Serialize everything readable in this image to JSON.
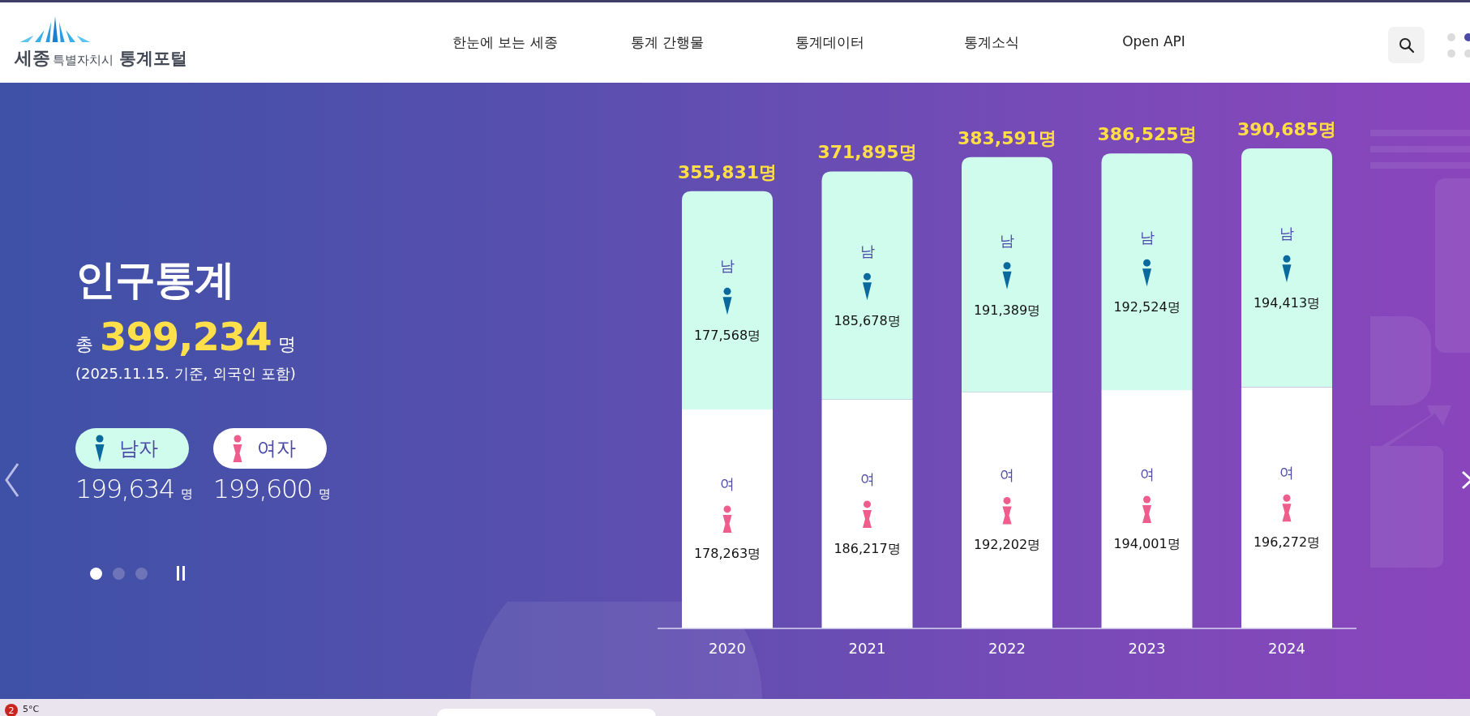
{
  "header": {
    "logo": {
      "city": "세종",
      "sub": "특별자치시",
      "portal": "통계포털"
    },
    "nav": [
      "한눈에 보는 세종",
      "통계 간행물",
      "통계데이터",
      "통계소식",
      "Open API"
    ]
  },
  "hero": {
    "title": "인구통계",
    "total": {
      "prefix": "총",
      "value": "399,234",
      "unit": "명"
    },
    "note": "(2025.11.15. 기준, 외국인 포함)",
    "genders": [
      {
        "kind": "male",
        "label": "남자",
        "value": "199,634",
        "unit": "명"
      },
      {
        "kind": "female",
        "label": "여자",
        "value": "199,600",
        "unit": "명"
      }
    ],
    "slides": [
      {
        "selected": true
      },
      {
        "selected": false
      },
      {
        "selected": false
      }
    ],
    "chart": {
      "bars": [
        {
          "total": "355,831명"
        },
        {
          "total": "371,895명"
        },
        {
          "total": "383,591명"
        },
        {
          "total": "386,525명"
        },
        {
          "total": "390,685명"
        }
      ],
      "chart_data": {
        "type": "bar",
        "stacked": true,
        "categories": [
          "2020",
          "2021",
          "2022",
          "2023",
          "2024"
        ],
        "series": [
          {
            "name": "남",
            "color": "#cffcec",
            "values": [
              177568,
              185678,
              191389,
              192524,
              194413
            ],
            "value_labels": [
              "177,568명",
              "185,678명",
              "191,389명",
              "192,524명",
              "194,413명"
            ]
          },
          {
            "name": "여",
            "color": "#ffffff",
            "values": [
              178263,
              186217,
              192202,
              194001,
              196272
            ],
            "value_labels": [
              "178,263명",
              "186,217명",
              "192,202명",
              "194,001명",
              "196,272명"
            ]
          }
        ]
      }
    }
  },
  "taskbar": {
    "badge": "2",
    "weather": "5°C"
  }
}
